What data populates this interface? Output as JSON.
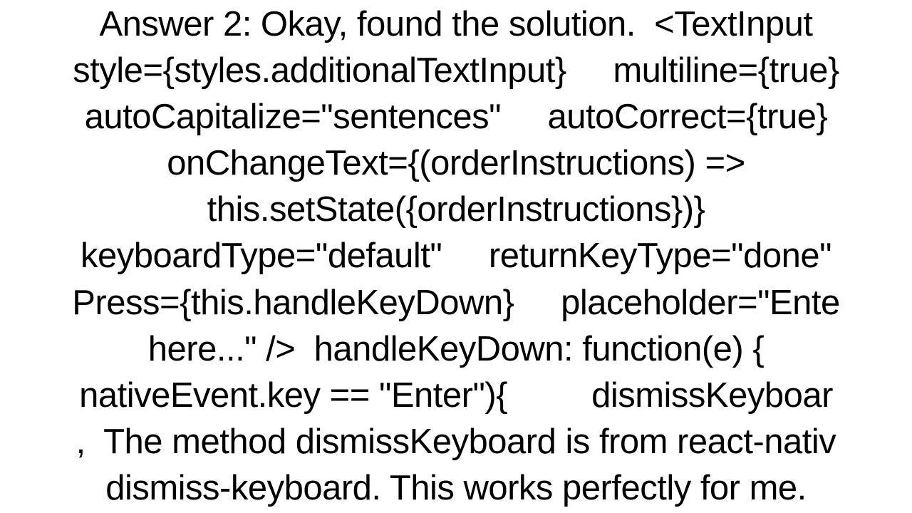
{
  "answer": {
    "text": "Answer 2: Okay, found the solution.  <TextInput\nstyle={styles.additionalTextInput}     multiline={true}\nautoCapitalize=\"sentences\"     autoCorrect={true}\nonChangeText={(orderInstructions) =>\nthis.setState({orderInstructions})}\nkeyboardType=\"default\"     returnKeyType=\"done\"\nPress={this.handleKeyDown}     placeholder=\"Ente\nhere...\" />  handleKeyDown: function(e) {\nnativeEvent.key == \"Enter\"){         dismissKeyboar\n,  The method dismissKeyboard is from react-nativ\ndismiss-keyboard. This works perfectly for me."
  }
}
